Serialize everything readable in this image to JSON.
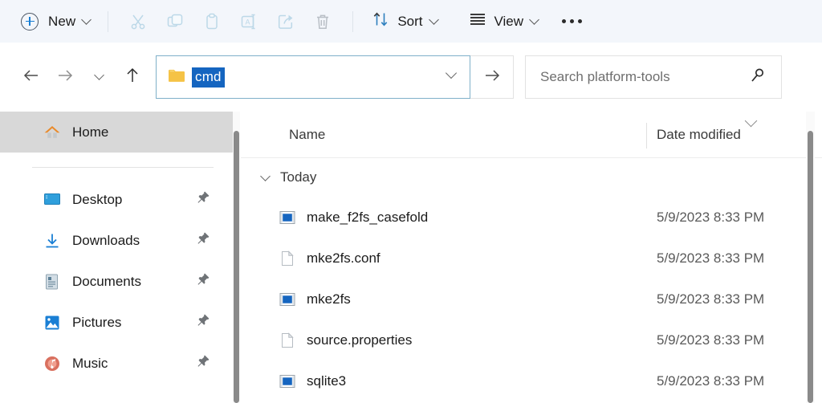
{
  "toolbar": {
    "new_label": "New",
    "new_icon": "plus-circle-icon",
    "cut_icon": "scissors-icon",
    "copy_icon": "copy-icon",
    "paste_icon": "clipboard-icon",
    "rename_icon": "rename-icon",
    "share_icon": "share-icon",
    "delete_icon": "trash-icon",
    "sort_label": "Sort",
    "sort_icon": "sort-arrows-icon",
    "view_label": "View",
    "view_icon": "list-lines-icon",
    "more_icon": "ellipsis-icon"
  },
  "navigation": {
    "back_icon": "arrow-left-icon",
    "forward_icon": "arrow-right-icon",
    "recent_icon": "chevron-down-icon",
    "up_icon": "arrow-up-icon",
    "go_icon": "arrow-right-icon"
  },
  "address": {
    "folder_icon": "folder-icon",
    "text": "cmd",
    "dropdown_icon": "chevron-down-icon"
  },
  "search": {
    "placeholder": "Search platform-tools",
    "icon": "search-icon"
  },
  "sidebar": {
    "items": [
      {
        "label": "Home",
        "icon": "home-icon",
        "selected": true,
        "pinned": false
      },
      {
        "label": "Desktop",
        "icon": "desktop-icon",
        "selected": false,
        "pinned": true
      },
      {
        "label": "Downloads",
        "icon": "download-icon",
        "selected": false,
        "pinned": true
      },
      {
        "label": "Documents",
        "icon": "document-icon",
        "selected": false,
        "pinned": true
      },
      {
        "label": "Pictures",
        "icon": "pictures-icon",
        "selected": false,
        "pinned": true
      },
      {
        "label": "Music",
        "icon": "music-icon",
        "selected": false,
        "pinned": true
      }
    ]
  },
  "file_list": {
    "columns": {
      "name": "Name",
      "date_modified": "Date modified"
    },
    "sort_indicator": "chevron-down-icon",
    "group_label": "Today",
    "group_chevron": "chevron-down-icon",
    "rows": [
      {
        "name": "make_f2fs_casefold",
        "icon": "application-icon",
        "date": "5/9/2023 8:33 PM"
      },
      {
        "name": "mke2fs.conf",
        "icon": "file-icon",
        "date": "5/9/2023 8:33 PM"
      },
      {
        "name": "mke2fs",
        "icon": "application-icon",
        "date": "5/9/2023 8:33 PM"
      },
      {
        "name": "source.properties",
        "icon": "file-icon",
        "date": "5/9/2023 8:33 PM"
      },
      {
        "name": "sqlite3",
        "icon": "application-icon",
        "date": "5/9/2023 8:33 PM"
      }
    ]
  },
  "colors": {
    "toolbar_bg": "#f3f6fb",
    "accent_blue": "#1a7fd4",
    "selection_blue": "#1565c0",
    "focus_border": "#7fb0c9",
    "selected_row": "#d8d8d8",
    "folder_yellow": "#f5c346"
  }
}
